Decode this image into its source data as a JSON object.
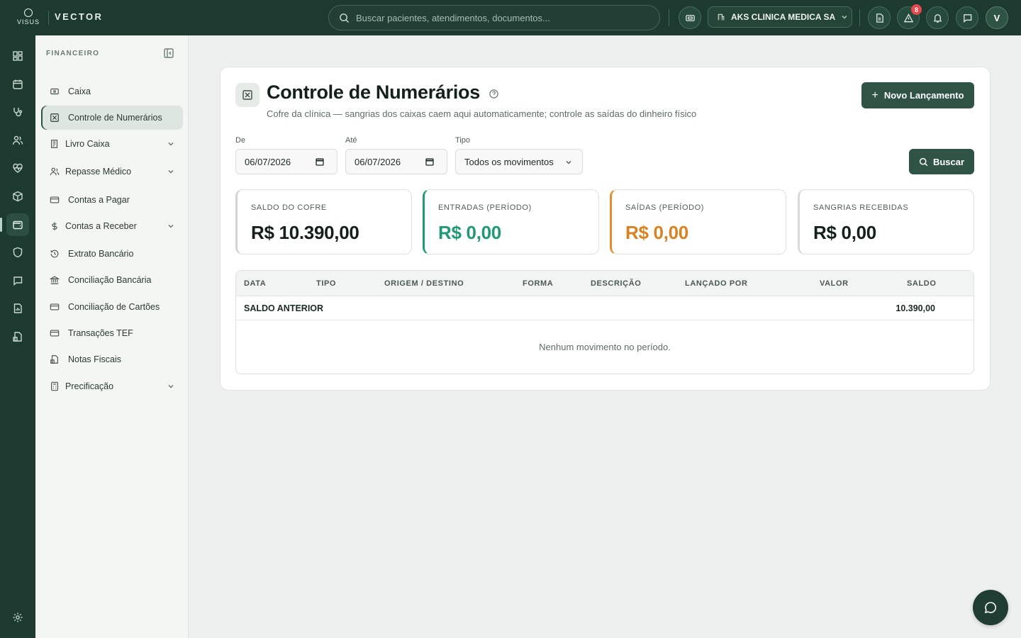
{
  "topbar": {
    "logo_text": "VISUS",
    "brand": "VECTOR",
    "search_placeholder": "Buscar pacientes, atendimentos, documentos...",
    "org_name": "AKS CLINICA MEDICA SA",
    "alerts_count": "8",
    "user_initial": "V"
  },
  "sidebar": {
    "section_title": "FINANCEIRO",
    "items": [
      {
        "label": "Caixa",
        "icon": "cash-register-icon"
      },
      {
        "label": "Controle de Numerários",
        "icon": "vault-icon",
        "active": true
      },
      {
        "label": "Livro Caixa",
        "icon": "ledger-icon",
        "expandable": true
      },
      {
        "label": "Repasse Médico",
        "icon": "users-icon",
        "expandable": true
      },
      {
        "label": "Contas a Pagar",
        "icon": "card-icon"
      },
      {
        "label": "Contas a Receber",
        "icon": "dollar-icon",
        "expandable": true
      },
      {
        "label": "Extrato Bancário",
        "icon": "history-icon"
      },
      {
        "label": "Conciliação Bancária",
        "icon": "bank-icon"
      },
      {
        "label": "Conciliação de Cartões",
        "icon": "card-icon"
      },
      {
        "label": "Transações TEF",
        "icon": "card-icon"
      },
      {
        "label": "Notas Fiscais",
        "icon": "invoice-icon"
      },
      {
        "label": "Precificação",
        "icon": "calculator-icon",
        "expandable": true
      }
    ]
  },
  "page": {
    "title": "Controle de Numerários",
    "subtitle": "Cofre da clínica — sangrias dos caixas caem aqui automaticamente; controle as saídas do dinheiro físico",
    "new_button": "Novo Lançamento",
    "filters": {
      "from_label": "De",
      "from_value": "06/07/2026",
      "to_label": "Até",
      "to_value": "06/07/2026",
      "type_label": "Tipo",
      "type_value": "Todos os movimentos"
    },
    "search_button": "Buscar",
    "stats": [
      {
        "label": "SALDO DO COFRE",
        "value": "R$ 10.390,00",
        "color": "#14201b"
      },
      {
        "label": "ENTRADAS (PERÍODO)",
        "value": "R$ 0,00",
        "color": "#1e9a75"
      },
      {
        "label": "SAÍDAS (PERÍODO)",
        "value": "R$ 0,00",
        "color": "#d9821f"
      },
      {
        "label": "SANGRIAS RECEBIDAS",
        "value": "R$ 0,00",
        "color": "#14201b"
      }
    ],
    "table": {
      "columns": [
        "DATA",
        "TIPO",
        "ORIGEM / DESTINO",
        "FORMA",
        "DESCRIÇÃO",
        "LANÇADO POR",
        "VALOR",
        "SALDO"
      ],
      "previous_balance_label": "SALDO ANTERIOR",
      "previous_balance_value": "10.390,00",
      "empty_message": "Nenhum movimento no período."
    }
  },
  "colors": {
    "primary": "#2f5446",
    "topbar": "#1d3a31",
    "accent_green": "#1e9a75",
    "accent_orange": "#d9821f",
    "alert_badge": "#e5484d"
  }
}
